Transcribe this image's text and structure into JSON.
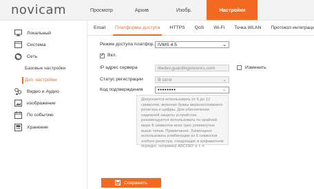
{
  "header": {
    "logo": "novicam",
    "nav": [
      "Просмотр",
      "Архив",
      "Изобр.",
      "Настройки"
    ],
    "active_nav": "Настройки"
  },
  "sidebar": {
    "items": [
      {
        "label": "Локальный",
        "icon": "monitor-icon"
      },
      {
        "label": "Система",
        "icon": "system-icon"
      },
      {
        "label": "Сеть",
        "icon": "globe-icon"
      },
      {
        "label": "Видео и Аудио",
        "icon": "video-audio-icon"
      },
      {
        "label": "изображение",
        "icon": "image-icon"
      },
      {
        "label": "По событию",
        "icon": "calendar-icon"
      },
      {
        "label": "Хранение",
        "icon": "storage-icon"
      }
    ],
    "subitems": [
      "Базовые настройки",
      "Доп. настройки"
    ],
    "active_subitem": "Доп. настройки"
  },
  "tabs": [
    "Email",
    "Платформы доступа",
    "HTTPS",
    "QoS",
    "Wi-Fi",
    "Точка WLAN",
    "Протокол интеграции"
  ],
  "active_tab": "Платформы доступа",
  "form": {
    "mode_label": "Режим доступа платфор...",
    "mode_value": "IVMS 4.5",
    "enable_label": "Вкл.",
    "enable_checked": true,
    "server_ip_label": "IP адрес сервера",
    "server_ip_value": "litedev.guardingvisionru.com",
    "change_label": "Изменить",
    "change_checked": false,
    "reg_status_label": "Статус регистрации",
    "reg_status_value": "В сети",
    "code_label": "Код подтверждения",
    "code_value": "••••••••",
    "hint": "Допускается использовать от 6 до 12 символов, включая буквы верхнего/нижнего регистра и цифры. Для обеспечения надежной защиты устройства рекомендуется использовать по крайней мере 8 символов всех трех упомянутых выше типов. Примечание. Запрещено использовать комбинации из 6 символов любого регистра, следующие в алфавитном порядке, например ABCDEF и т. п."
  },
  "save_button": "Сохранить",
  "colors": {
    "accent": "#f26a21"
  }
}
